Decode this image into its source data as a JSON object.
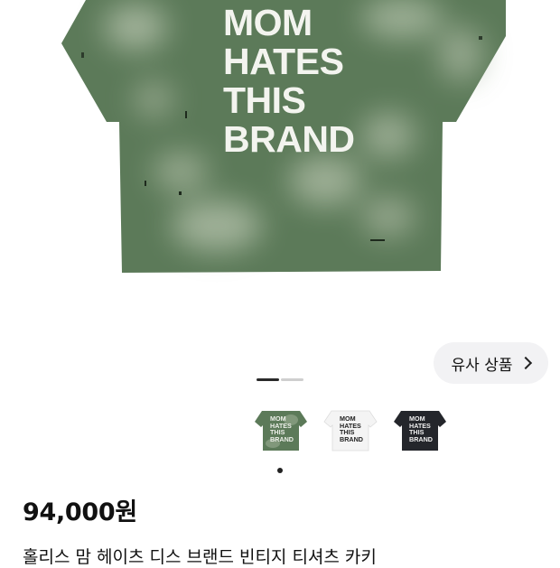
{
  "product": {
    "shirt_print": [
      "MOM",
      "HATES",
      "THIS",
      "BRAND"
    ],
    "price": "94,000원",
    "title": "홀리스 맘 헤이츠 디스 브랜드 빈티지 티셔츠 카키"
  },
  "similar_button": {
    "label": "유사 상품"
  },
  "thumbnails": [
    {
      "color": "khaki",
      "print": [
        "MOM",
        "HATES",
        "THIS",
        "BRAND"
      ]
    },
    {
      "color": "white",
      "print": [
        "MOM",
        "HATES",
        "THIS",
        "BRAND"
      ]
    },
    {
      "color": "black",
      "print": [
        "MOM",
        "HATES",
        "THIS",
        "BRAND"
      ]
    }
  ],
  "colors": {
    "khaki": "#5c7a59",
    "white": "#f4f4f4",
    "black": "#24262b"
  },
  "carousel": {
    "current_page": 1,
    "total_pages": 2
  }
}
